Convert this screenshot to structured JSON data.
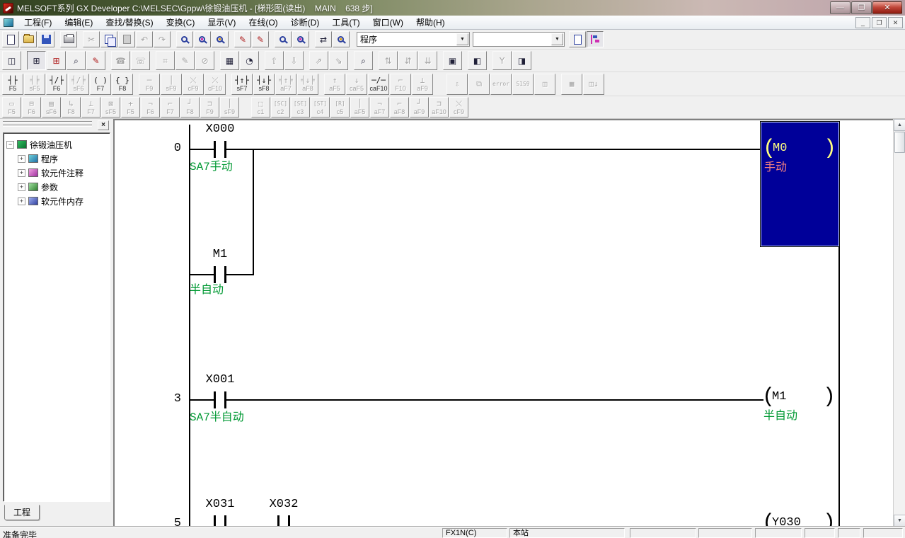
{
  "titlebar": {
    "title": "MELSOFT系列 GX Developer C:\\MELSEC\\Gppw\\徐锻油压机 - [梯形图(读出)    MAIN    638 步]"
  },
  "menubar": {
    "items": [
      "工程(F)",
      "编辑(E)",
      "查找/替换(S)",
      "变换(C)",
      "显示(V)",
      "在线(O)",
      "诊断(D)",
      "工具(T)",
      "窗口(W)",
      "帮助(H)"
    ]
  },
  "toolbar_main": {
    "program_combo_value": "程序",
    "find_combo_value": ""
  },
  "toolbar_row2": {
    "buttons": [
      [
        [
          "◫",
          "program-common-button",
          "en"
        ]
      ],
      [
        [
          "⊞",
          "ladder-display-button",
          "press"
        ],
        [
          "⊞",
          "ladder-edit-button",
          "red"
        ],
        [
          "⌕",
          "device-find-button",
          "en"
        ],
        [
          "✎",
          "comment-edit-button",
          "red"
        ]
      ],
      [
        [
          "☎",
          "connection-setup-button",
          "dis"
        ],
        [
          "☏",
          "disconnect-button",
          "dis"
        ]
      ],
      [
        [
          "⌗",
          "monitor-17-button",
          "dis"
        ],
        [
          "✎",
          "monitor-edit-button",
          "dis"
        ],
        [
          "⊘",
          "monitor-test-button",
          "dis"
        ]
      ],
      [
        [
          "▦",
          "device-batch-button",
          "en"
        ],
        [
          "◔",
          "entry-monitor-button",
          "en"
        ]
      ],
      [
        [
          "⇧",
          "monitor-start-button",
          "dis"
        ],
        [
          "⇩",
          "monitor-stop-button",
          "dis"
        ]
      ],
      [
        [
          "⇗",
          "window-prev-button",
          "dis"
        ],
        [
          "⇘",
          "window-next-button",
          "dis"
        ]
      ],
      [
        [
          "⌕",
          "device-test-button",
          "en"
        ]
      ],
      [
        [
          "⇅",
          "param-up-button",
          "dis"
        ],
        [
          "⇵",
          "param-updown-button",
          "dis"
        ],
        [
          "⇊",
          "param-down-button",
          "dis"
        ]
      ],
      [
        [
          "▣",
          "buffer-memory-monitor-button",
          "en"
        ]
      ],
      [
        [
          "◧",
          "doc-list-button",
          "en"
        ]
      ],
      [
        [
          "Y",
          "filter-button",
          "dis"
        ],
        [
          "◨",
          "window-edit-button",
          "en"
        ]
      ]
    ]
  },
  "ladder_symbol_bar": {
    "groups": [
      [
        [
          "┤├",
          "F5",
          1
        ],
        [
          "╡╞",
          "sF5",
          0
        ],
        [
          "┤/├",
          "F6",
          1
        ],
        [
          "╡/╞",
          "sF6",
          0
        ],
        [
          "( )",
          "F7",
          1
        ],
        [
          "{ }",
          "F8",
          1
        ]
      ],
      [
        [
          "─",
          "F9",
          0
        ],
        [
          "│",
          "sF9",
          0
        ],
        [
          "⤬",
          "cF9",
          0
        ],
        [
          "⤫",
          "cF10",
          0
        ]
      ],
      [
        [
          "┤↑├",
          "sF7",
          1
        ],
        [
          "┤↓├",
          "sF8",
          1
        ],
        [
          "╡↑╞",
          "aF7",
          0
        ],
        [
          "╡↓╞",
          "aF8",
          0
        ]
      ],
      [
        [
          "↑",
          "aF5",
          0
        ],
        [
          "↓",
          "caF5",
          0
        ],
        [
          "─/─",
          "caF10",
          1
        ],
        [
          "⌐",
          "F10",
          0
        ],
        [
          "⊥",
          "aF9",
          0
        ]
      ]
    ],
    "right_groups": [
      [
        [
          "⇩",
          "write-during-run-button"
        ],
        [
          "⧉",
          "cascade-windows-button"
        ],
        [
          "error",
          "error-jump-button"
        ],
        [
          "S1S9",
          "sort-button"
        ],
        [
          "◫",
          "block-monitor-button"
        ]
      ],
      [
        [
          "▦",
          "test-grid-button"
        ],
        [
          "◫↓",
          "tree-down-button"
        ]
      ]
    ]
  },
  "line_symbol_bar": {
    "groups": [
      [
        [
          "▭",
          "F5"
        ],
        [
          "⊟",
          "F6"
        ],
        [
          "▤",
          "sF6"
        ],
        [
          "↳",
          "F8"
        ],
        [
          "⊥",
          "F7"
        ],
        [
          "⊠",
          "sF5"
        ],
        [
          "+",
          "F5"
        ],
        [
          "¬",
          "F6"
        ],
        [
          "⌐",
          "F7"
        ],
        [
          "┘",
          "F8"
        ],
        [
          "⊐",
          "F9"
        ],
        [
          "│",
          "sF9"
        ]
      ],
      [
        [
          "⬚",
          "c1"
        ],
        [
          "[SC]",
          "c2"
        ],
        [
          "[SE]",
          "c3"
        ],
        [
          "[ST]",
          "c4"
        ],
        [
          "[R]",
          "c5"
        ],
        [
          "│",
          "aF5"
        ],
        [
          "¬",
          "aF7"
        ],
        [
          "⌐",
          "aF8"
        ],
        [
          "┘",
          "aF9"
        ],
        [
          "⊐",
          "aF10"
        ],
        [
          "⤬",
          "cF9"
        ]
      ]
    ]
  },
  "project_tree": {
    "root": "徐锻油压机",
    "items": [
      "程序",
      "软元件注释",
      "参数",
      "软元件内存"
    ],
    "item_icons": [
      "program-icon",
      "device-comment-icon",
      "parameter-icon",
      "device-memory-icon"
    ],
    "tab": "工程"
  },
  "ladder": {
    "coil_open": "(",
    "coil_close": ")",
    "rung0": {
      "step": "0",
      "contact_device": "X000",
      "contact_comment": "SA7手动",
      "branch_device": "M1",
      "branch_comment": "半自动",
      "coil_device": "M0",
      "coil_comment": "手动"
    },
    "rung1": {
      "step": "3",
      "contact_device": "X001",
      "contact_comment": "SA7半自动",
      "coil_device": "M1",
      "coil_comment": "半自动"
    },
    "rung2": {
      "step": "5",
      "contact1_device": "X031",
      "contact2_device": "X032",
      "coil_device": "Y030"
    }
  },
  "statusbar": {
    "message": "准备完毕",
    "plc_type": "FX1N(C)",
    "station": "本站"
  },
  "icons": {
    "minimize": "—",
    "restore": "❐",
    "close": "✕",
    "mdi_minimize": "_",
    "mdi_restore": "❐",
    "mdi_close": "✕",
    "panel_close": "×",
    "combo_arrow": "▼",
    "scroll_up": "▲",
    "scroll_down": "▼",
    "tree_collapse": "−",
    "tree_expand": "+"
  },
  "colors": {
    "comment_green": "#009933",
    "selection_blue": "#000099",
    "selected_text_yellow": "#ffff80",
    "selected_comment_pink": "#f08080"
  }
}
